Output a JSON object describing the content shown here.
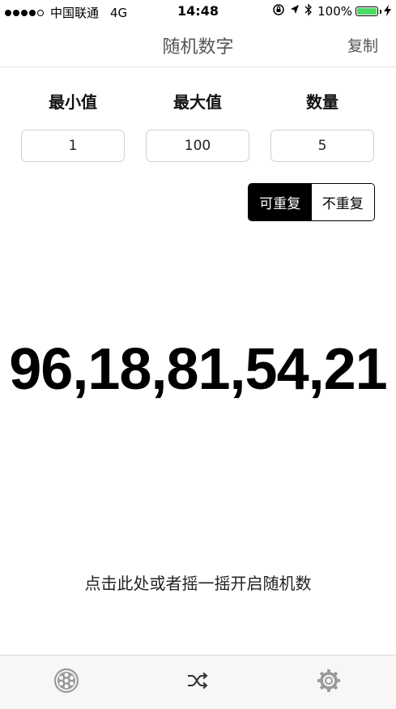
{
  "status_bar": {
    "carrier": "中国联通",
    "network": "4G",
    "time": "14:48",
    "battery_pct": "100%",
    "battery_level": 1.0,
    "signal_bars": 4,
    "signal_total": 5,
    "icons": [
      "orientation-lock-icon",
      "location-arrow-icon",
      "bluetooth-icon",
      "battery-icon",
      "charging-bolt-icon"
    ],
    "battery_color": "#4cd964"
  },
  "nav": {
    "title": "随机数字",
    "copy_label": "复制"
  },
  "settings": {
    "min_label": "最小值",
    "max_label": "最大值",
    "count_label": "数量",
    "min_value": "1",
    "max_value": "100",
    "count_value": "5"
  },
  "mode": {
    "repeat_label": "可重复",
    "no_repeat_label": "不重复",
    "selected": "repeat"
  },
  "result": {
    "text": "96,18,81,54,21"
  },
  "hint": "点击此处或者摇一摇开启随机数",
  "tabs": {
    "icons": [
      "dice-icon",
      "shuffle-icon",
      "gear-icon"
    ],
    "active_color": "#333333",
    "inactive_color": "#999999"
  }
}
